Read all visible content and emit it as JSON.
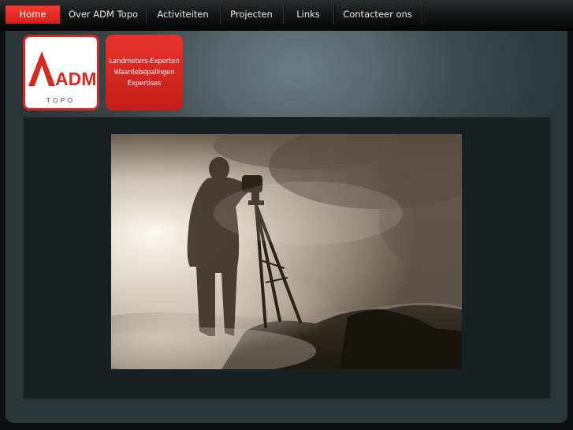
{
  "nav": {
    "items": [
      {
        "label": "Home",
        "active": true
      },
      {
        "label": "Over ADM Topo",
        "active": false
      },
      {
        "label": "Activiteiten",
        "active": false
      },
      {
        "label": "Projecten",
        "active": false
      },
      {
        "label": "Links",
        "active": false
      },
      {
        "label": "Contacteer ons",
        "active": false
      }
    ],
    "accent_color": "#e0241e"
  },
  "logo": {
    "brand": "ADM",
    "tagline": "TOPO",
    "color": "#d42a24"
  },
  "services": {
    "lines": [
      "Landmeters-Experten",
      "Waardebepalingen",
      "Expertises"
    ]
  },
  "hero": {
    "subject": "surveyor-with-theodolite-in-mist-photo"
  }
}
